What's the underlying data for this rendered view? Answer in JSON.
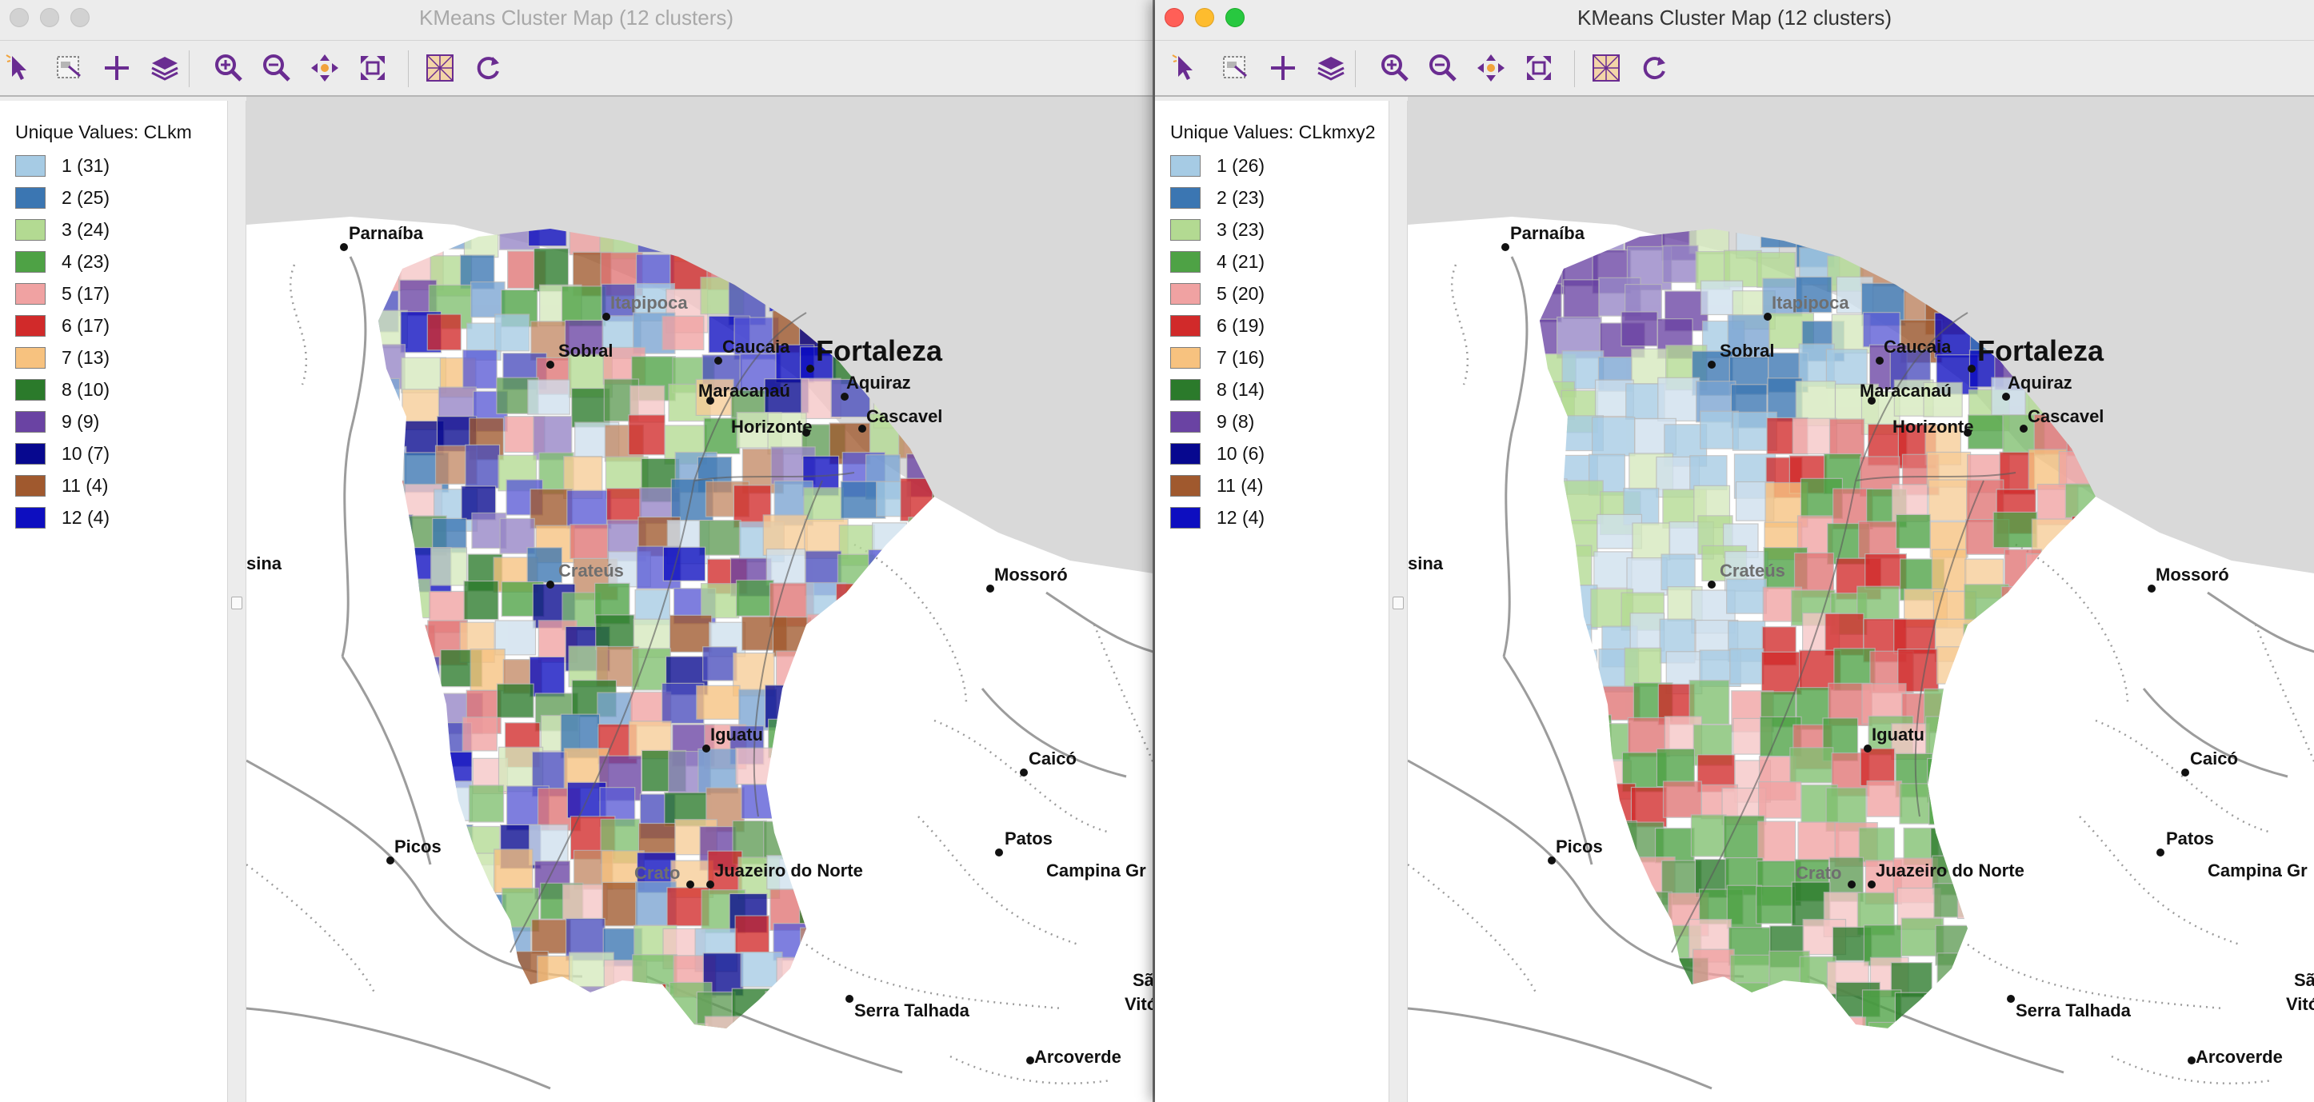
{
  "windows": [
    {
      "title": "KMeans Cluster Map (12 clusters)",
      "active": false,
      "legend": {
        "title": "Unique Values: CLkm",
        "items": [
          {
            "label": "1 (31)",
            "color": "#a6cbe4"
          },
          {
            "label": "2 (25)",
            "color": "#3b76b2"
          },
          {
            "label": "3 (24)",
            "color": "#b3da92"
          },
          {
            "label": "4 (23)",
            "color": "#4ea245"
          },
          {
            "label": "5 (17)",
            "color": "#f0a2a2"
          },
          {
            "label": "6 (17)",
            "color": "#d12a2a"
          },
          {
            "label": "7 (13)",
            "color": "#f7c27f"
          },
          {
            "label": "8 (10)",
            "color": "#2b7a2b"
          },
          {
            "label": "9 (9)",
            "color": "#6a43a3"
          },
          {
            "label": "10 (7)",
            "color": "#07088f"
          },
          {
            "label": "11 (4)",
            "color": "#a0592e"
          },
          {
            "label": "12 (4)",
            "color": "#0d0ec0"
          }
        ]
      }
    },
    {
      "title": "KMeans Cluster Map (12 clusters)",
      "active": true,
      "legend": {
        "title": "Unique Values: CLkmxy2",
        "items": [
          {
            "label": "1 (26)",
            "color": "#a6cbe4"
          },
          {
            "label": "2 (23)",
            "color": "#3b76b2"
          },
          {
            "label": "3 (23)",
            "color": "#b3da92"
          },
          {
            "label": "4 (21)",
            "color": "#4ea245"
          },
          {
            "label": "5 (20)",
            "color": "#f0a2a2"
          },
          {
            "label": "6 (19)",
            "color": "#d12a2a"
          },
          {
            "label": "7 (16)",
            "color": "#f7c27f"
          },
          {
            "label": "8 (14)",
            "color": "#2b7a2b"
          },
          {
            "label": "9 (8)",
            "color": "#6a43a3"
          },
          {
            "label": "10 (6)",
            "color": "#07088f"
          },
          {
            "label": "11 (4)",
            "color": "#a0592e"
          },
          {
            "label": "12 (4)",
            "color": "#0d0ec0"
          }
        ]
      }
    }
  ],
  "toolbar_icons": [
    "select-icon",
    "selection-options-icon",
    "add-icon",
    "layers-icon",
    "zoom-in-icon",
    "zoom-out-icon",
    "pan-icon",
    "full-extent-icon",
    "basemap-icon",
    "refresh-icon"
  ],
  "map": {
    "cities": {
      "parnaiba": "Parnaíba",
      "itapipoca": "Itapipoca",
      "sobral": "Sobral",
      "caucaia": "Caucaia",
      "fortaleza": "Fortaleza",
      "aquiraz": "Aquiraz",
      "maracanau": "Maracanaú",
      "cascavel": "Cascavel",
      "horizonte": "Horizonte",
      "teresina_partial": "sina",
      "crateus": "Crateús",
      "mossoro": "Mossoró",
      "iguatu": "Iguatu",
      "caico": "Caicó",
      "picos": "Picos",
      "patos": "Patos",
      "campina_grande_partial": "Campina Gr",
      "crato": "Crato",
      "juazeiro": "Juazeiro do Norte",
      "sa_partial": "Sã",
      "vitoria_partial": "Vitória d",
      "serra_talhada": "Serra Talhada",
      "arcoverde": "Arcoverde"
    }
  }
}
